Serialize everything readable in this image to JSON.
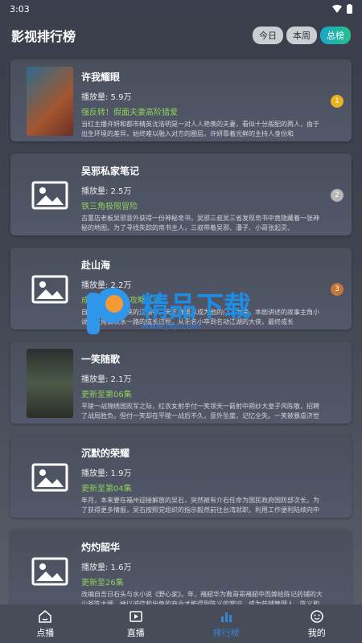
{
  "status": {
    "time": "3:03"
  },
  "header": {
    "title": "影视排行榜",
    "tabs": [
      "今日",
      "本周",
      "总榜"
    ],
    "active_tab": 2
  },
  "items": [
    {
      "title": "许我耀眼",
      "plays": "播放量: 5.9万",
      "tag": "强反转！假面夫妻高阶猎爱",
      "desc": "当红主播许妍和都市精英沈洛明是一对人人艳羡的夫妻，看似十分般配的两人，由于出生环境的差异，始终难以融入对方的圈层。许妍靠着光鲜的主持人身份和",
      "rank": "1",
      "rank_color": "#e8b320",
      "thumb": "poster1"
    },
    {
      "title": "吴邪私家笔记",
      "plays": "播放量: 2.5万",
      "tag": "铁三角极限冒险",
      "desc": "古董店老板吴邪意外获得一份神秘帛书，吴邪三叔吴三省发现帛书中竟隐藏着一张神秘的地图。为了寻找失踪的帛书主人，三叔带着吴邪、潘子、小哥张起灵、",
      "rank": "2",
      "rank_color": "#b6b6b6",
      "thumb": "placeholder"
    },
    {
      "title": "赴山海",
      "plays": "播放量: 2.2万",
      "tag": "成毅领衔热血攻略江湖",
      "desc": "自幼为之一统武侠的江湖中，天下群雄以成为他的门下为荣。本剧讲述的故事主角小说男主角萧秋水一路的成长过程，从无名小卒到名动江湖的大侠，最终成长",
      "rank": "3",
      "rank_color": "#c7753a",
      "thumb": "placeholder"
    },
    {
      "title": "一笑随歌",
      "plays": "播放量: 2.1万",
      "tag": "更新至第06集",
      "desc": "平陵一战锦绣国败军之际，红衣女射手付一笑领天一箭射中朔纱大皇子风陈敬，招聘了战局胜负。但付一笑却在平陵一战后不久，意外坠崖，记忆全失。一笑被暴虐济世的",
      "rank": "",
      "rank_color": "",
      "thumb": "poster2"
    },
    {
      "title": "沉默的荣耀",
      "plays": "播放量: 1.9万",
      "tag": "更新至第04集",
      "desc": "年月，本来要在福州迎接解放的吴石，突然被有介石任命为国民政府国防部次长。为了获得更多情报，吴石按照党组织的指示毅然前往台湾就职，利用工作便利陆续向中共华东",
      "rank": "",
      "rank_color": "",
      "thumb": "placeholder"
    },
    {
      "title": "灼灼韶华",
      "plays": "播放量: 1.6万",
      "tag": "更新至26集",
      "desc": "改编自吾日石头与水小说《野心家》。年，褚韶华为救哥哥褚韶中而嫁给陈记药铺的大少爷陈大顺，她以诚信和出色的商业才能得到陈义的赏识，成为药铺管理人。陈义和陈大",
      "rank": "",
      "rank_color": "",
      "thumb": "placeholder"
    }
  ],
  "tabbar": {
    "items": [
      "点播",
      "直播",
      "排行榜",
      "我的"
    ],
    "active": 2
  },
  "watermark": {
    "text": "精品下载",
    "url": "www.j9p.com"
  }
}
